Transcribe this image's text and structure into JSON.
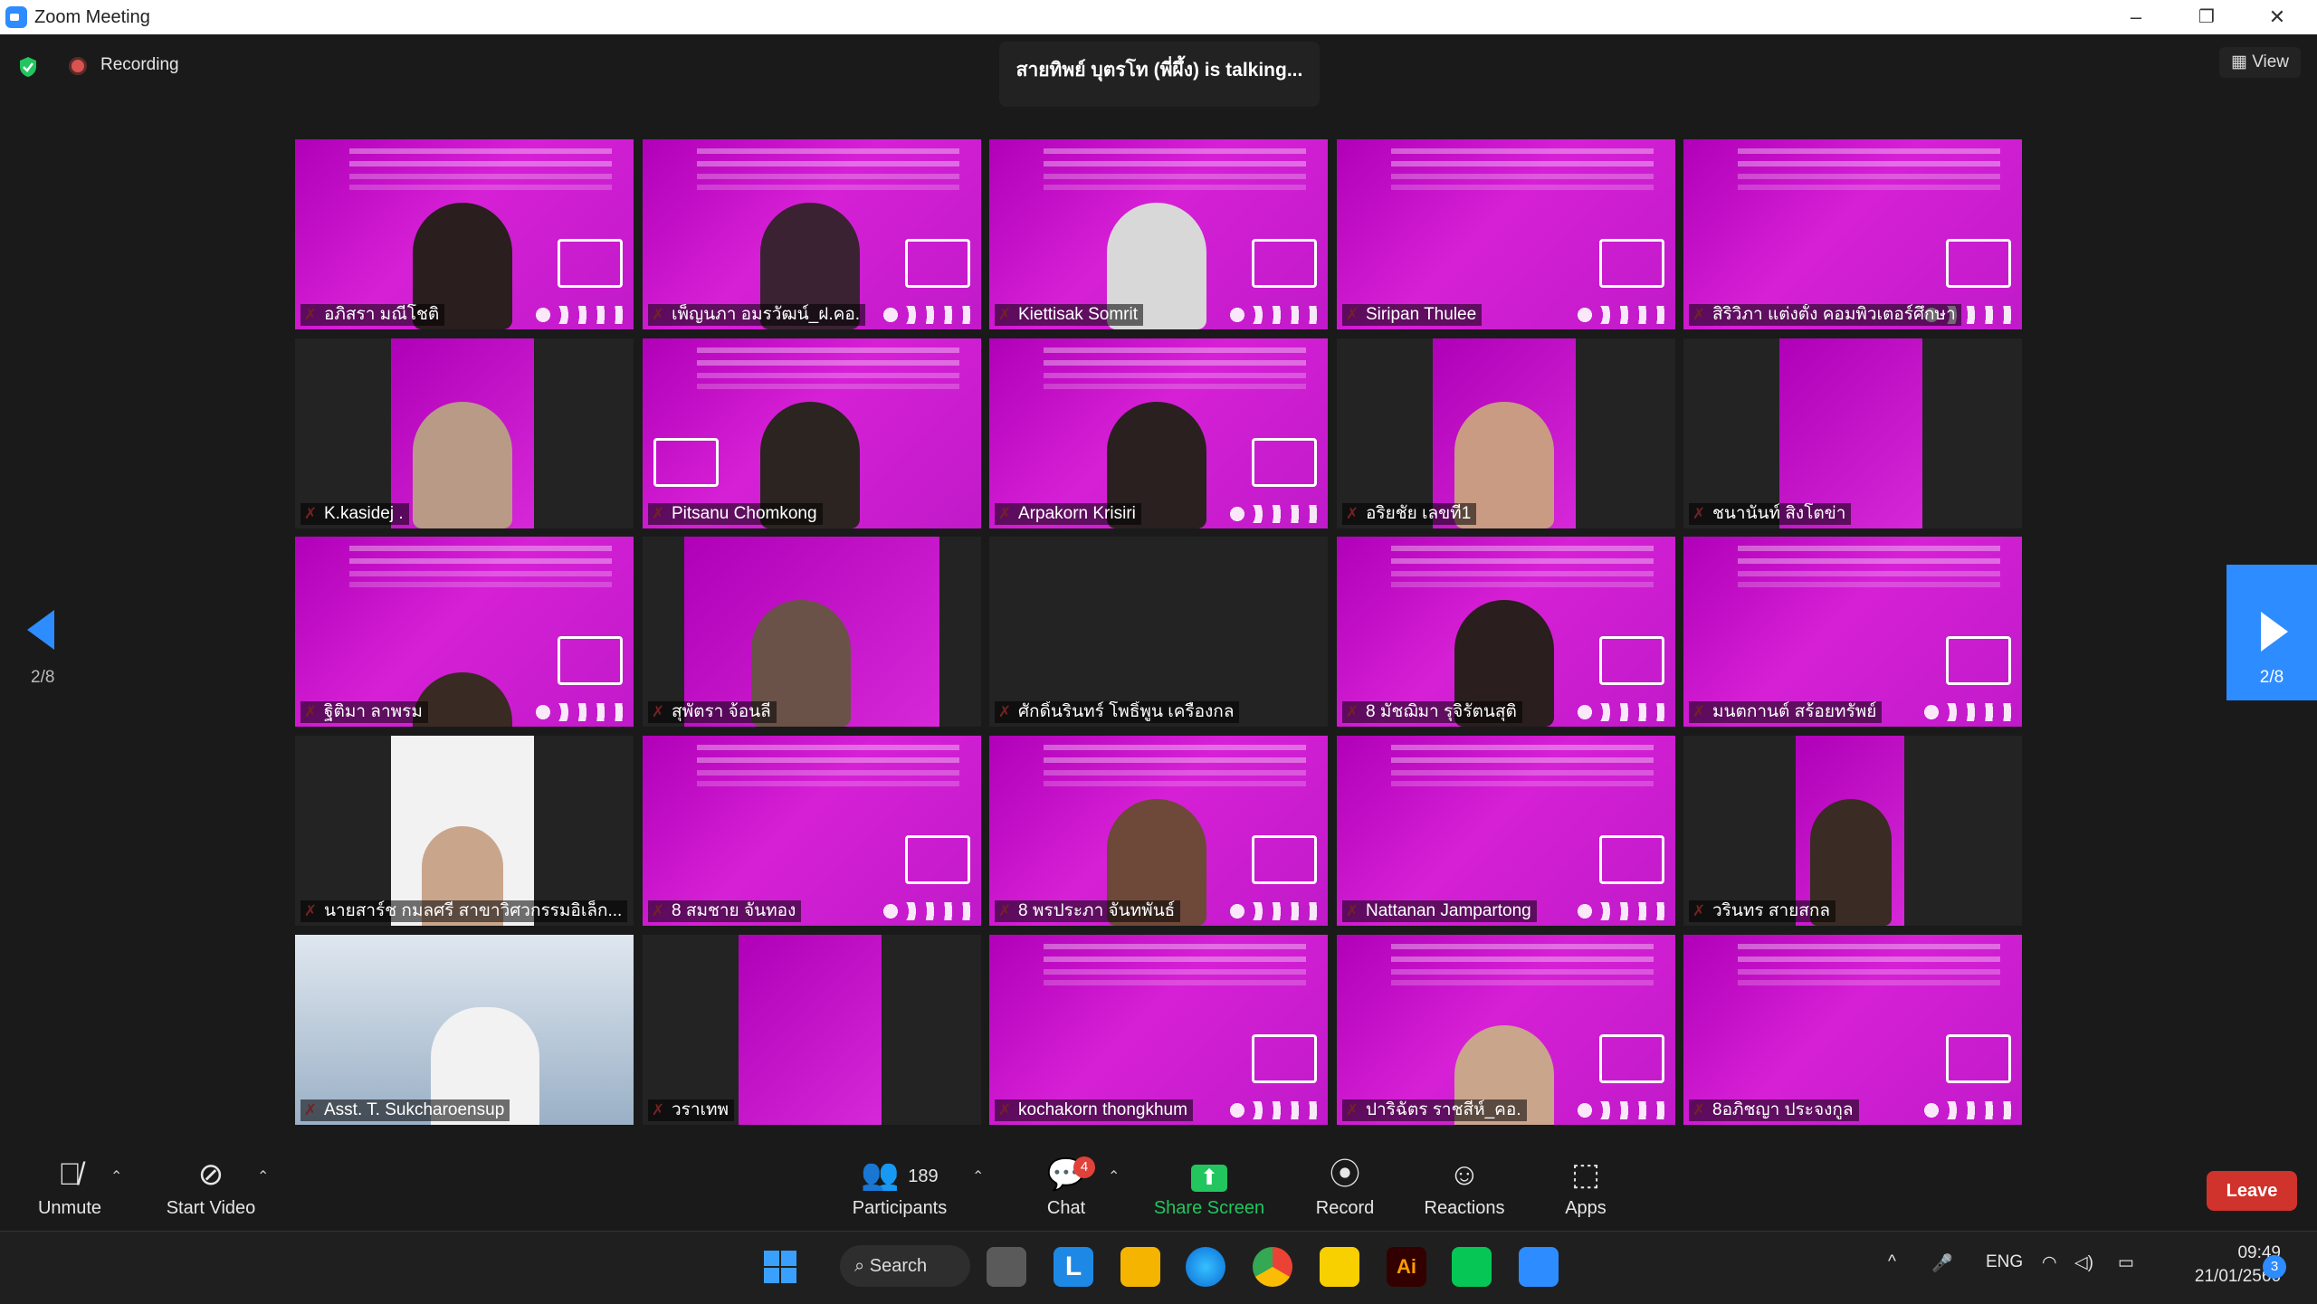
{
  "window": {
    "title": "Zoom Meeting",
    "minimize": "–",
    "restore": "❐",
    "close": "✕"
  },
  "top": {
    "recording_label": "Recording",
    "talking_text": "สายทิพย์ บุตรโท (พี่ผึ้ง) is talking...",
    "view_label": "View"
  },
  "nav": {
    "left_page": "2/8",
    "right_page": "2/8"
  },
  "participants": [
    {
      "name": "อภิสรา มณีโชติ"
    },
    {
      "name": "เพ็ญนภา อมรวัฒน์_ฝ.คอ."
    },
    {
      "name": "Kiettisak Somrit"
    },
    {
      "name": "Siripan Thulee"
    },
    {
      "name": "สิริวิภา แต่งตั้ง คอมพิวเตอร์ศึกษา"
    },
    {
      "name": "K.kasidej ."
    },
    {
      "name": "Pitsanu Chomkong"
    },
    {
      "name": "Arpakorn Krisiri"
    },
    {
      "name": "อริยชัย เลขที่1"
    },
    {
      "name": "ชนานันท์ สิงโตข่า"
    },
    {
      "name": "ฐิติมา ลาพรม"
    },
    {
      "name": "สุพัตรา จ้อนลี"
    },
    {
      "name": "ศักดิ์นรินทร์ โพธิ์พูน เครื่องกล"
    },
    {
      "name": "8 มัชฌิมา รุจิรัตนสุติ"
    },
    {
      "name": "มนตกานต์ สร้อยทรัพย์"
    },
    {
      "name": "นายสาร์ช กมลศรี สาขาวิศวกรรมอิเล็ก..."
    },
    {
      "name": "8 สมชาย จันทอง"
    },
    {
      "name": "8 พรประภา จันทพันธ์"
    },
    {
      "name": "Nattanan Jampartong"
    },
    {
      "name": "วรินทร สายสกล"
    },
    {
      "name": "Asst. T. Sukcharoensup"
    },
    {
      "name": "วราเทพ"
    },
    {
      "name": "kochakorn thongkhum"
    },
    {
      "name": "ปาริฉัตร ราชสีห์_คอ."
    },
    {
      "name": "8อภิชญา ประจงกูล"
    }
  ],
  "toolbar": {
    "unmute": "Unmute",
    "start_video": "Start Video",
    "participants_label": "Participants",
    "participants_count": "189",
    "chat_label": "Chat",
    "chat_badge": "4",
    "share_label": "Share Screen",
    "record_label": "Record",
    "reactions_label": "Reactions",
    "apps_label": "Apps",
    "leave_label": "Leave"
  },
  "taskbar": {
    "search_label": "Search",
    "lang": "ENG",
    "time": "09:49",
    "date": "21/01/2566",
    "notif_count": "3"
  },
  "colors": {
    "accent": "#2d8cff",
    "leave": "#d0322c",
    "share": "#22c55e",
    "slide": "#c412c9",
    "muted": "#ff4d4d"
  }
}
